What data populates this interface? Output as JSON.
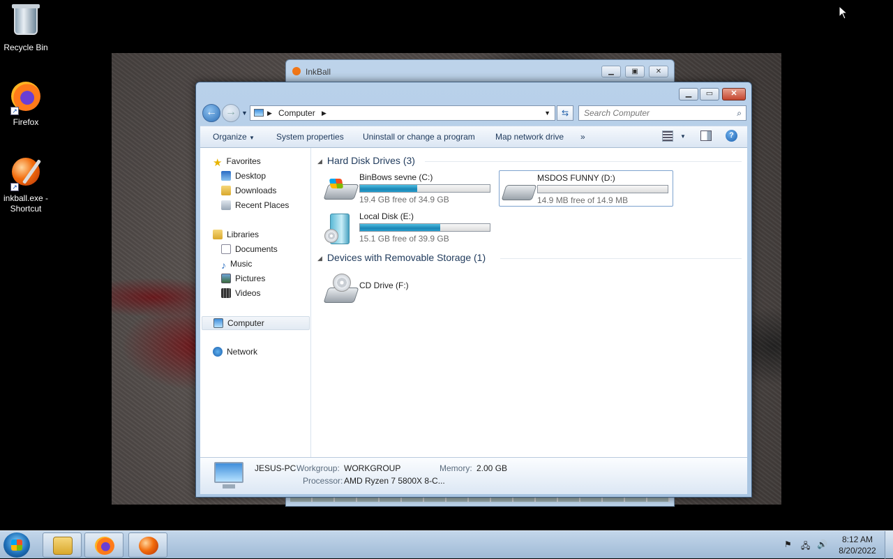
{
  "desktop": {
    "icons": [
      {
        "label": "Recycle Bin",
        "icon": "recycle-bin-icon"
      },
      {
        "label": "Firefox",
        "icon": "firefox-icon"
      },
      {
        "label": "inkball.exe - Shortcut",
        "icon": "inkball-icon"
      }
    ]
  },
  "inkball_window": {
    "title": "InkBall"
  },
  "explorer": {
    "address_current": "Computer",
    "search_placeholder": "Search Computer",
    "toolbar": {
      "organize": "Organize",
      "system_properties": "System properties",
      "uninstall": "Uninstall or change a program",
      "map_drive": "Map network drive",
      "more": "»"
    },
    "nav": {
      "favorites": "Favorites",
      "desktop": "Desktop",
      "downloads": "Downloads",
      "recent": "Recent Places",
      "libraries": "Libraries",
      "documents": "Documents",
      "music": "Music",
      "pictures": "Pictures",
      "videos": "Videos",
      "computer": "Computer",
      "network": "Network"
    },
    "groups": {
      "hard_disks": "Hard Disk Drives (3)",
      "removable": "Devices with Removable Storage (1)"
    },
    "drives": [
      {
        "name": "BinBows sevne (C:)",
        "free": "19.4 GB free of 34.9 GB",
        "used_fraction": 0.44
      },
      {
        "name": "MSDOS FUNNY (D:)",
        "free": "14.9 MB free of 14.9 MB",
        "used_fraction": 0.0
      },
      {
        "name": "Local Disk (E:)",
        "free": "15.1 GB free of 39.9 GB",
        "used_fraction": 0.62
      }
    ],
    "cd_drive": "CD Drive (F:)",
    "details": {
      "pc_name": "JESUS-PC",
      "workgroup_label": "Workgroup:",
      "workgroup": "WORKGROUP",
      "memory_label": "Memory:",
      "memory": "2.00 GB",
      "processor_label": "Processor:",
      "processor": "AMD Ryzen 7 5800X 8-C..."
    }
  },
  "taskbar": {
    "time": "8:12 AM",
    "date": "8/20/2022"
  }
}
